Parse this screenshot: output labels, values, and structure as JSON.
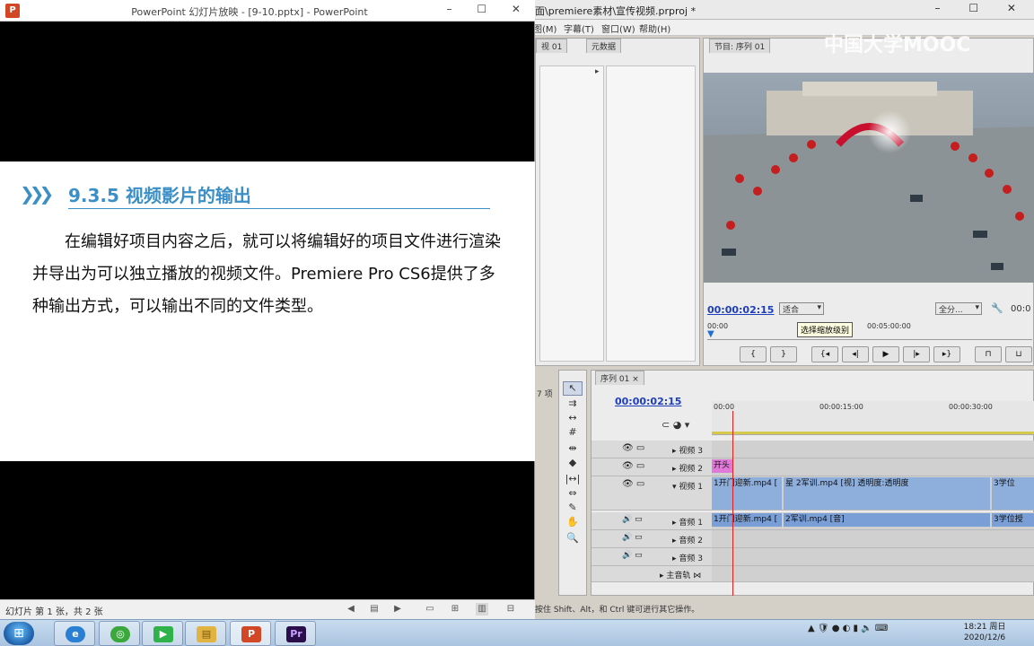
{
  "premiere": {
    "title": "面\\premiere素材\\宣传视频.prproj *",
    "menus": [
      "图(M)",
      "字幕(T)",
      "窗口(W)",
      "帮助(H)"
    ],
    "project_tabs": [
      "视 01",
      "元数据"
    ],
    "program_tab": "节目: 序列 01",
    "timecode_program": "00:00:02:15",
    "fit_dropdown": "适合",
    "full_dropdown": "全分...",
    "timecode_right": "00:0",
    "tooltip": "选择缩放级别",
    "ruler_start": "00:00",
    "ruler_mid": "00:05:00:00",
    "sequence_tab": "序列 01",
    "timecode_timeline": "00:00:02:15",
    "timeline_ruler": [
      "00:00",
      "00:00:15:00",
      "00:00:30:00"
    ],
    "project_items_hint": "7 项",
    "tracks": {
      "v3": "视频 3",
      "v2": "视频 2",
      "v1": "视频 1",
      "a1": "音频 1",
      "a2": "音频 2",
      "a3": "音频 3",
      "master": "主音轨"
    },
    "clips": {
      "v2_title": "开头",
      "v1_clip1": "1开门迎新.mp4 [",
      "v1_clip2_prefix": "星",
      "v1_clip2": "2军训.mp4 [视] 透明度:透明度",
      "v1_clip3": "3学位",
      "a1_clip1": "1开门迎新.mp4 [",
      "a1_clip2": "2军训.mp4 [音]",
      "a1_clip3": "3学位授"
    },
    "status_text": "按住 Shift、Alt，和 Ctrl 键可进行其它操作。"
  },
  "powerpoint": {
    "title": "PowerPoint 幻灯片放映 - [9-10.pptx] - PowerPoint",
    "icon_letter": "P",
    "slide_heading": "9.3.5  视频影片的输出",
    "slide_body": "　　在编辑好项目内容之后，就可以将编辑好的项目文件进行渲染并导出为可以独立播放的视频文件。Premiere Pro CS6提供了多种输出方式，可以输出不同的文件类型。",
    "status": "幻灯片 第 1 张，共 2 张"
  },
  "watermark": "中国大学MOOC",
  "taskbar": {
    "start": "⊞",
    "apps": [
      {
        "name": "ie",
        "label": "e",
        "color": "#2a7fd4"
      },
      {
        "name": "360",
        "label": "◎",
        "color": "#3aa83a"
      },
      {
        "name": "player",
        "label": "▶",
        "color": "#2fb24a"
      },
      {
        "name": "explorer",
        "label": "▤",
        "color": "#e3b341"
      },
      {
        "name": "powerpoint",
        "label": "P",
        "color": "#d24726"
      },
      {
        "name": "premiere",
        "label": "Pr",
        "color": "#2a0e4a"
      }
    ],
    "clock_time": "18:21 周日",
    "clock_date": "2020/12/6"
  }
}
